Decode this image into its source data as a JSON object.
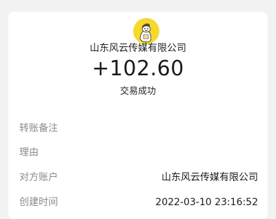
{
  "transaction": {
    "merchant_name": "山东风云传媒有限公司",
    "amount": "+102.60",
    "status": "交易成功",
    "avatar_icon": "duck-character-avatar",
    "avatar_color": "#f6d92b"
  },
  "details": [
    {
      "label": "转账备注",
      "value": ""
    },
    {
      "label": "理由",
      "value": ""
    },
    {
      "label": "对方账户",
      "value": "山东风云传媒有限公司"
    },
    {
      "label": "创建时间",
      "value": "2022-03-10 23:16:52"
    }
  ]
}
